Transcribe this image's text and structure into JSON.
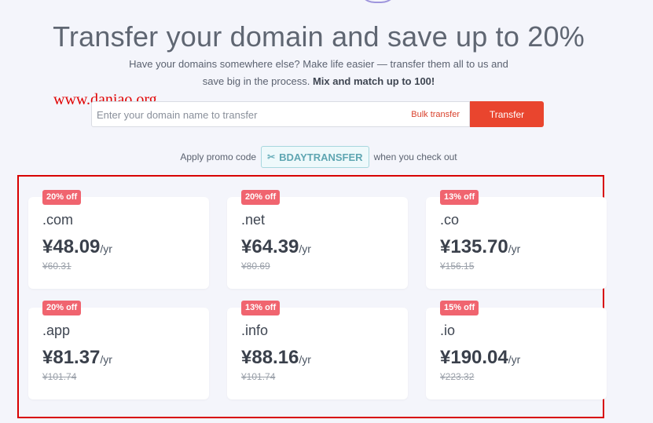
{
  "hero": {
    "title": "Transfer your domain and save up to 20%",
    "subtitle_line1": "Have your domains somewhere else? Make life easier — transfer them all to us and",
    "subtitle_line2_start": "save big in the process.",
    "subtitle_bold": "Mix and match up to 100!"
  },
  "watermark": "www.daniao.org",
  "search": {
    "placeholder": "Enter your domain name to transfer",
    "value": "",
    "bulk_link": "Bulk transfer",
    "button": "Transfer"
  },
  "promo": {
    "before": "Apply promo code",
    "code": "BDAYTRANSFER",
    "after": "when you check out",
    "icon": "scissors-icon"
  },
  "cards": [
    {
      "badge": "20% off",
      "tld": ".com",
      "price": "¥48.09",
      "unit": "/yr",
      "old_price": "¥60.31"
    },
    {
      "badge": "20% off",
      "tld": ".net",
      "price": "¥64.39",
      "unit": "/yr",
      "old_price": "¥80.69"
    },
    {
      "badge": "13% off",
      "tld": ".co",
      "price": "¥135.70",
      "unit": "/yr",
      "old_price": "¥156.15"
    },
    {
      "badge": "20% off",
      "tld": ".app",
      "price": "¥81.37",
      "unit": "/yr",
      "old_price": "¥101.74"
    },
    {
      "badge": "13% off",
      "tld": ".info",
      "price": "¥88.16",
      "unit": "/yr",
      "old_price": "¥101.74"
    },
    {
      "badge": "15% off",
      "tld": ".io",
      "price": "¥190.04",
      "unit": "/yr",
      "old_price": "¥223.32"
    }
  ],
  "colors": {
    "accent": "#e9452e",
    "badge": "#f0646f",
    "promo": "#5fa6b2",
    "highlight_frame": "#d80000"
  }
}
